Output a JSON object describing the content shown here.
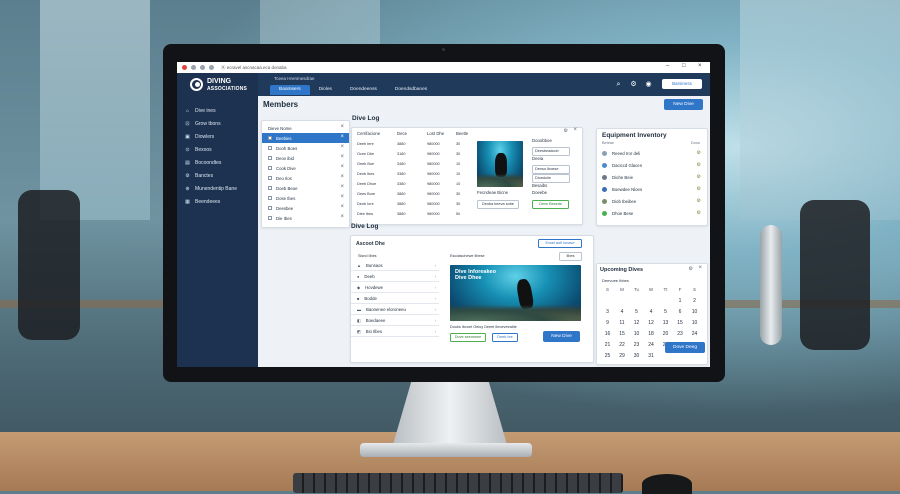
{
  "app": {
    "url": "Ⓐ ecravel ascnacaa.eca donaba",
    "logo_title": "DIVING",
    "logo_subtitle": "ASSOCIATIONS",
    "header_sub": "Tceea Hrenmesdrae",
    "top_button": "Barsiness",
    "tabs": [
      "Baomsers",
      "Dioles",
      "Doendeenss",
      "Doendsdbanes"
    ],
    "active_tab": 0
  },
  "sidebar": {
    "items": [
      {
        "icon": "⌂",
        "label": "Dive ines"
      },
      {
        "icon": "⊡",
        "label": "Grow tbons"
      },
      {
        "icon": "▣",
        "label": "Diowlers"
      },
      {
        "icon": "⊙",
        "label": "Bexoos"
      },
      {
        "icon": "▤",
        "label": "Bocoondtes"
      },
      {
        "icon": "⚙",
        "label": "Banctes"
      },
      {
        "icon": "⊕",
        "label": "Munendentip Bane"
      },
      {
        "icon": "▦",
        "label": "Beendeees"
      }
    ]
  },
  "members": {
    "title": "Members",
    "new_dive_button": "New Dive",
    "list_header": "Dieve Nome",
    "rows": [
      "Beebies",
      "Dooh Boes",
      "Deov ibid",
      "Cook Dive",
      "Deo Ilos",
      "Doeb Beoe",
      "Dose Ibes",
      "Deesbee",
      "Die Ibes"
    ]
  },
  "dive_log_table": {
    "title": "Dive Log",
    "headers": [
      "Cerrifacione",
      "Dece",
      "Lost Dhe",
      "Beetle"
    ],
    "rows": [
      [
        "Deeb Iere",
        "3880",
        "980000",
        "30"
      ],
      [
        "Ocee Dbe",
        "3180",
        "980000",
        "30"
      ],
      [
        "Geeb Boe",
        "3480",
        "980000",
        "10"
      ],
      [
        "Deob Ibes",
        "3380",
        "980000",
        "10"
      ],
      [
        "Deeb Dhoe",
        "3380",
        "980000",
        "10"
      ],
      [
        "Gees Bore",
        "3880",
        "980000",
        "30"
      ],
      [
        "Deob Iore",
        "3880",
        "980000",
        "30"
      ],
      [
        "Diee Ibes",
        "3880",
        "980000",
        "5il"
      ]
    ],
    "details": [
      "Dooobboe",
      "Deesbeadoob",
      "Deeia",
      "Denso Iboese",
      "Dioedolie",
      "Besaibs"
    ],
    "caption": "Fecndeae Bicne",
    "caption2": "Doeebe",
    "btn1": "Deoba beeva sobe",
    "btn2": "Deve Beseds"
  },
  "equipment": {
    "title": "Equipment Inventory",
    "col1": "Beteae",
    "col2": "Doos",
    "rows": [
      {
        "label": "Reeed Iror deli",
        "color": "#8aa0b4"
      },
      {
        "label": "Daciccd Glacen",
        "color": "#4f8bc6"
      },
      {
        "label": "Diohe Beie",
        "color": "#6b7a8a"
      },
      {
        "label": "Boewdee Nloes",
        "color": "#3a6fb0"
      },
      {
        "label": "Diob Ibeibee",
        "color": "#7d8c6a"
      },
      {
        "label": "Dhoe Bese",
        "color": "#4caf50"
      }
    ]
  },
  "dive_log_card": {
    "title": "Dive Log",
    "sub_title": "Ascoot Dhe",
    "filter_btn": "Exsel aotl Ionave",
    "list_header": "Sisnd Ilbes",
    "col2": "Escdaschewe Ilbese",
    "select_btn": "Ilbes",
    "rows": [
      {
        "icon": "▲",
        "label": "Bunsaos"
      },
      {
        "icon": "●",
        "label": "Deeb"
      },
      {
        "icon": "◆",
        "label": "Hovdewe"
      },
      {
        "icon": "■",
        "label": "Bodde"
      },
      {
        "icon": "▬",
        "label": "Baonenee eloroneeu"
      },
      {
        "icon": "◧",
        "label": "Boedaeee"
      },
      {
        "icon": "◩",
        "label": "Bsi Ilbes"
      }
    ],
    "photo_caption_1": "Dive Inforeakeo",
    "photo_caption_2": "Dive Dhee",
    "footer": "Dooks Ibcoet Oeiuy Deeet Ileoeveeatile",
    "btn_green": "Dove seeonsee",
    "btn_blue": "Deeb Iee",
    "new_dive": "New Dive"
  },
  "calendar": {
    "title": "Upcoming Dives",
    "sub": "Deevoee Ibbes",
    "days": [
      "S",
      "M",
      "Tu",
      "W",
      "Tt",
      "F",
      "S"
    ],
    "weeks": [
      [
        "",
        "",
        "",
        "",
        "",
        "1",
        "2"
      ],
      [
        "3",
        "4",
        "5",
        "4",
        "5",
        "6",
        "10"
      ],
      [
        "9",
        "11",
        "12",
        "12",
        "13",
        "15",
        "10"
      ],
      [
        "16",
        "15",
        "10",
        "18",
        "20",
        "23",
        "24"
      ],
      [
        "21",
        "22",
        "23",
        "24",
        "25",
        "27",
        "26"
      ],
      [
        "25",
        "29",
        "30",
        "31",
        "",
        "",
        ""
      ]
    ],
    "button": "Dove Deeg"
  },
  "colors": {
    "accent": "#2f76c9",
    "sidebar": "#1d3250",
    "topnav": "#203a5c",
    "success": "#4caf50"
  }
}
